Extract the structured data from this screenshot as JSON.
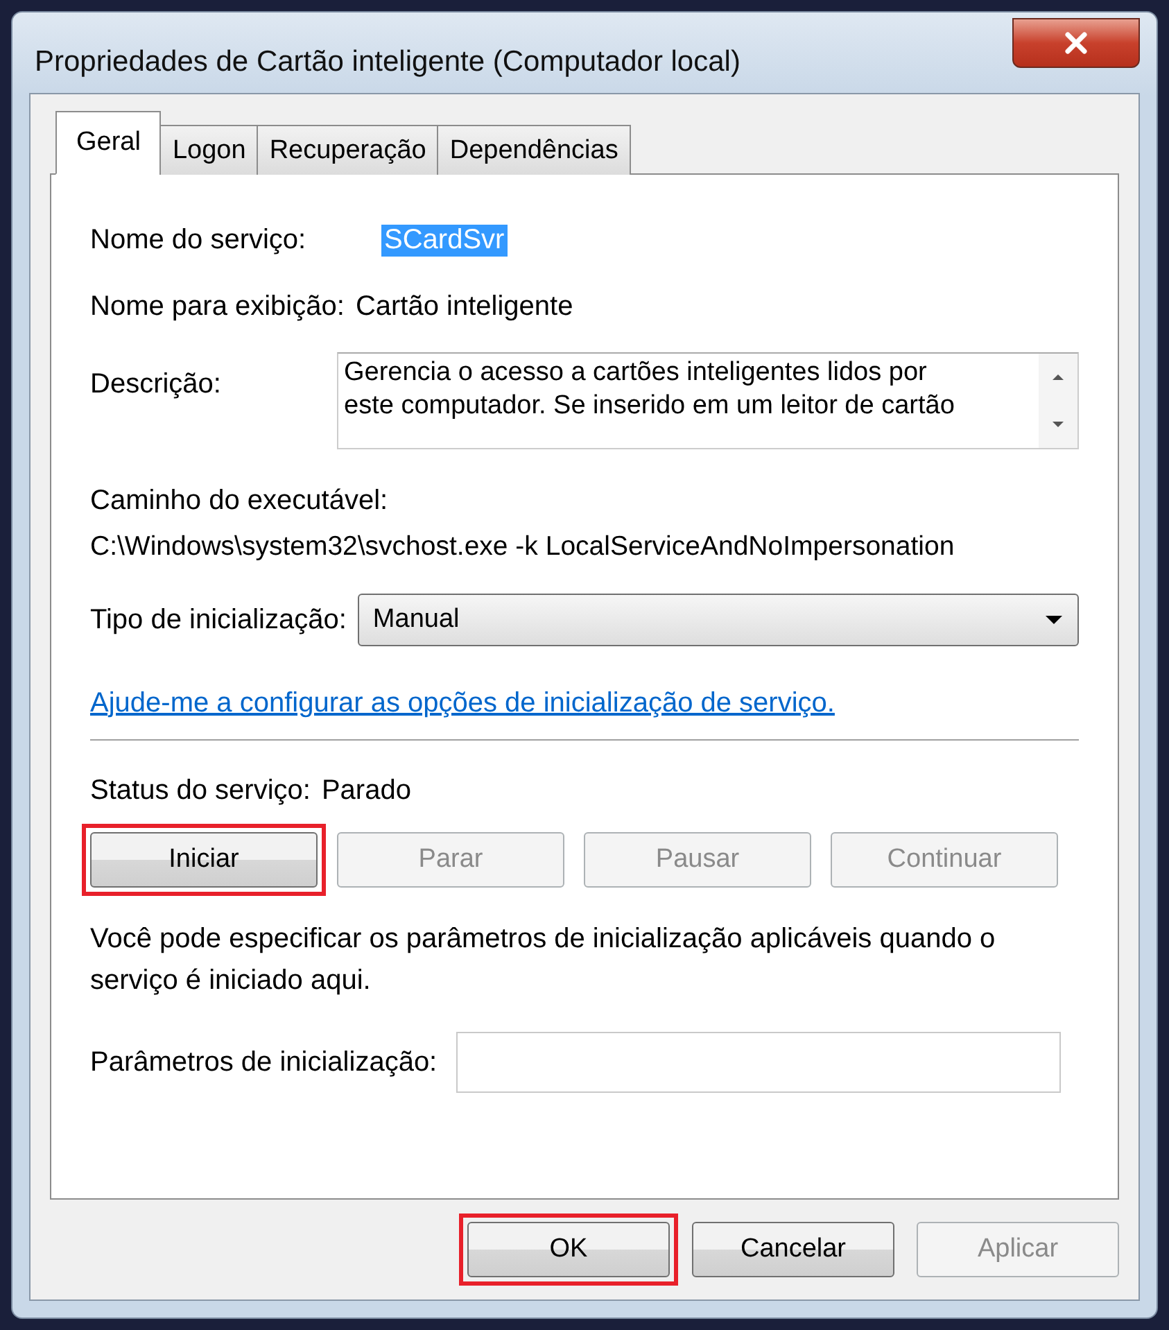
{
  "window": {
    "title": "Propriedades de Cartão inteligente (Computador local)"
  },
  "tabs": [
    {
      "label": "Geral",
      "selected": true
    },
    {
      "label": "Logon",
      "selected": false
    },
    {
      "label": "Recuperação",
      "selected": false
    },
    {
      "label": "Dependências",
      "selected": false
    }
  ],
  "service_name": {
    "label": "Nome do serviço:",
    "value": "SCardSvr",
    "selected": true
  },
  "display_name": {
    "label": "Nome para exibição:",
    "value": "Cartão inteligente"
  },
  "description": {
    "label": "Descrição:",
    "value": "Gerencia o acesso a cartões inteligentes lidos por este computador. Se inserido em um leitor de cartão"
  },
  "executable_path": {
    "label": "Caminho do executável:",
    "value": "C:\\Windows\\system32\\svchost.exe -k LocalServiceAndNoImpersonation"
  },
  "startup_type": {
    "label": "Tipo de inicialização:",
    "value": "Manual"
  },
  "help_link": "Ajude-me a configurar as opções de inicialização de serviço.",
  "service_status": {
    "label": "Status do serviço:",
    "value": "Parado"
  },
  "service_buttons": [
    {
      "label": "Iniciar",
      "disabled": false,
      "highlighted": true
    },
    {
      "label": "Parar",
      "disabled": true,
      "highlighted": false
    },
    {
      "label": "Pausar",
      "disabled": true,
      "highlighted": false
    },
    {
      "label": "Continuar",
      "disabled": true,
      "highlighted": false
    }
  ],
  "parameters_note": "Você pode especificar os parâmetros de inicialização aplicáveis quando o serviço é iniciado aqui.",
  "start_parameters": {
    "label": "Parâmetros de inicialização:"
  },
  "dialog_buttons": [
    {
      "label": "OK",
      "disabled": false,
      "highlighted": true
    },
    {
      "label": "Cancelar",
      "disabled": false,
      "highlighted": false
    },
    {
      "label": "Aplicar",
      "disabled": true,
      "highlighted": false
    }
  ]
}
